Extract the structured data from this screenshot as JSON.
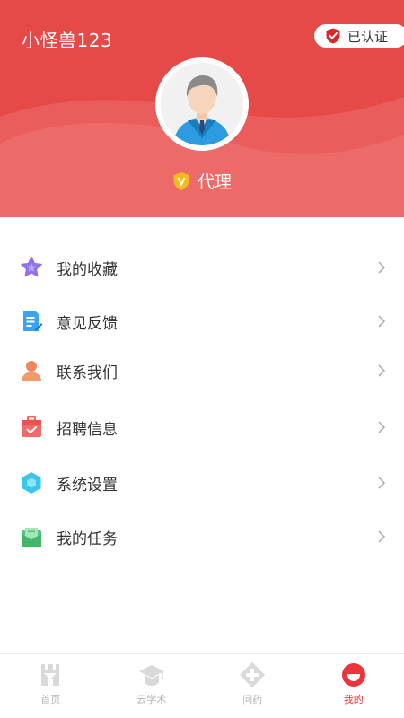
{
  "header": {
    "username": "小怪兽123",
    "verified_label": "已认证",
    "role_label": "代理"
  },
  "colors": {
    "brand_red": "#e64a48",
    "active_tab": "#e8363a",
    "inactive_tab": "#b5b5b5"
  },
  "menu": {
    "items": [
      {
        "label": "我的收藏",
        "icon": "star-icon"
      },
      {
        "label": "意见反馈",
        "icon": "document-edit-icon"
      },
      {
        "label": "联系我们",
        "icon": "person-icon"
      },
      {
        "label": "招聘信息",
        "icon": "briefcase-icon"
      },
      {
        "label": "系统设置",
        "icon": "hexagon-settings-icon"
      },
      {
        "label": "我的任务",
        "icon": "envelope-icon"
      }
    ]
  },
  "tabbar": {
    "tabs": [
      {
        "label": "首页",
        "icon": "home-icon",
        "active": false
      },
      {
        "label": "云学术",
        "icon": "graduation-cap-icon",
        "active": false
      },
      {
        "label": "问药",
        "icon": "medical-cross-icon",
        "active": false
      },
      {
        "label": "我的",
        "icon": "profile-icon",
        "active": true
      }
    ]
  }
}
